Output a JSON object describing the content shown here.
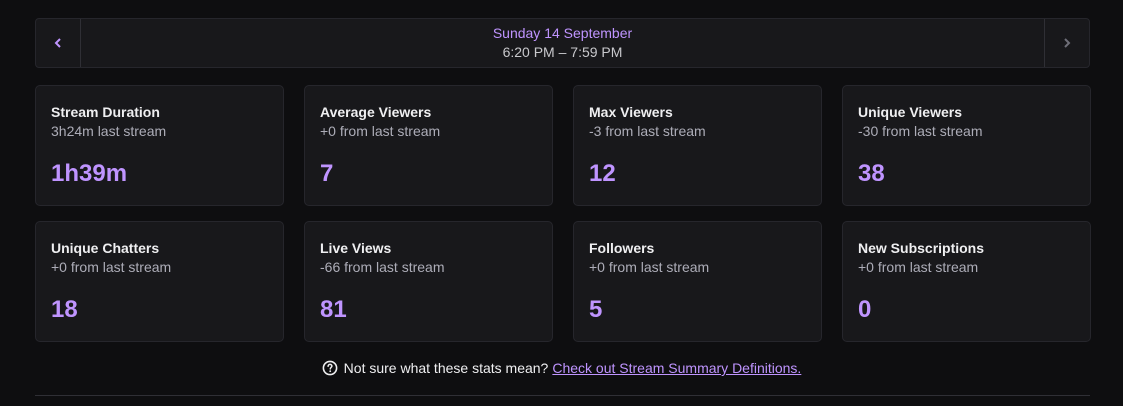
{
  "date_nav": {
    "title": "Sunday 14 September",
    "time_range": "6:20 PM – 7:59 PM",
    "prev_icon": "chevron-left-icon",
    "next_icon": "chevron-right-icon"
  },
  "stats": [
    {
      "title": "Stream Duration",
      "subtitle": "3h24m last stream",
      "value": "1h39m"
    },
    {
      "title": "Average Viewers",
      "subtitle": "+0 from last stream",
      "value": "7"
    },
    {
      "title": "Max Viewers",
      "subtitle": "-3 from last stream",
      "value": "12"
    },
    {
      "title": "Unique Viewers",
      "subtitle": "-30 from last stream",
      "value": "38"
    },
    {
      "title": "Unique Chatters",
      "subtitle": "+0 from last stream",
      "value": "18"
    },
    {
      "title": "Live Views",
      "subtitle": "-66 from last stream",
      "value": "81"
    },
    {
      "title": "Followers",
      "subtitle": "+0 from last stream",
      "value": "5"
    },
    {
      "title": "New Subscriptions",
      "subtitle": "+0 from last stream",
      "value": "0"
    }
  ],
  "help": {
    "icon": "question-circle-icon",
    "text": "Not sure what these stats mean?",
    "link_text": "Check out Stream Summary Definitions."
  },
  "colors": {
    "accent": "#bf94ff",
    "background": "#0e0e10",
    "card": "#18181b"
  }
}
